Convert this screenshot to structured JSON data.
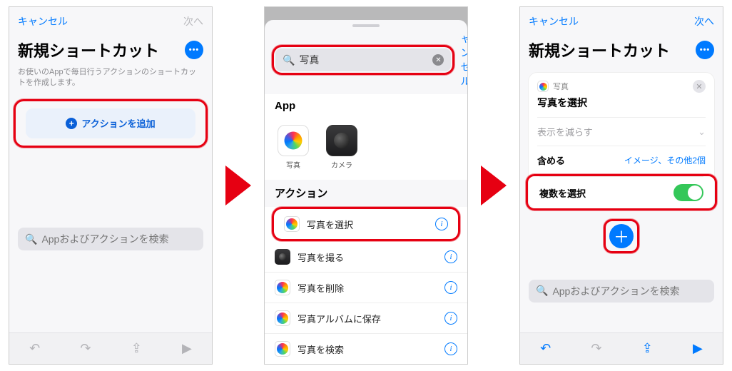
{
  "screen1": {
    "nav": {
      "cancel": "キャンセル",
      "next": "次へ"
    },
    "title": "新規ショートカット",
    "subtitle": "お使いのAppで毎日行うアクションのショートカットを作成します。",
    "add_action": "アクションを追加",
    "search_placeholder": "Appおよびアクションを検索"
  },
  "screen2": {
    "search_value": "写真",
    "cancel": "ャンセル",
    "section_app": "App",
    "apps": {
      "photos": "写真",
      "camera": "カメラ"
    },
    "section_actions": "アクション",
    "actions": {
      "select_photos": "写真を選択",
      "take_photo": "写真を撮る",
      "delete_photos": "写真を削除",
      "save_to_album": "写真アルバムに保存",
      "search_photos": "写真を検索"
    }
  },
  "screen3": {
    "nav": {
      "cancel": "キャンセル",
      "next": "次へ"
    },
    "title": "新規ショートカット",
    "card": {
      "app_label": "写真",
      "action_title": "写真を選択",
      "show_less": "表示を減らす",
      "include": "含める",
      "include_value": "イメージ、その他2個",
      "multi_select": "複数を選択"
    },
    "search_placeholder": "Appおよびアクションを検索"
  }
}
